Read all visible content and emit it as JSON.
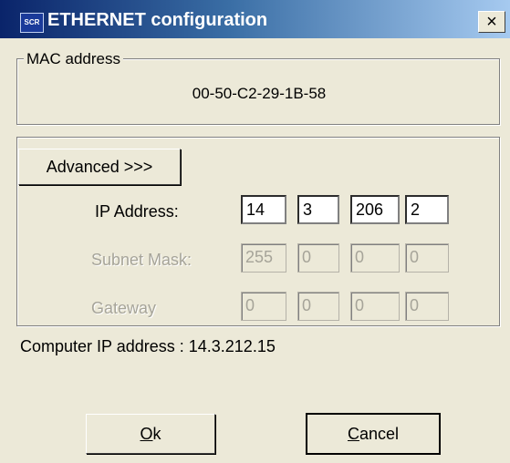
{
  "window": {
    "title": "ETHERNET configuration",
    "title_icon_text": "SCR",
    "close_glyph": "×"
  },
  "mac": {
    "legend": "MAC address",
    "value": "00-50-C2-29-1B-58"
  },
  "advanced": {
    "button_label": "Advanced >>>"
  },
  "ip": {
    "label": "IP Address:",
    "octets": [
      "14",
      "3",
      "206",
      "2"
    ]
  },
  "subnet": {
    "label": "Subnet Mask:",
    "octets": [
      "255",
      "0",
      "0",
      "0"
    ]
  },
  "gateway": {
    "label": "Gateway",
    "octets": [
      "0",
      "0",
      "0",
      "0"
    ]
  },
  "computer_ip": {
    "text": "Computer IP address : 14.3.212.15"
  },
  "buttons": {
    "ok_accel": "O",
    "ok_rest": "k",
    "cancel_accel": "C",
    "cancel_rest": "ancel"
  }
}
